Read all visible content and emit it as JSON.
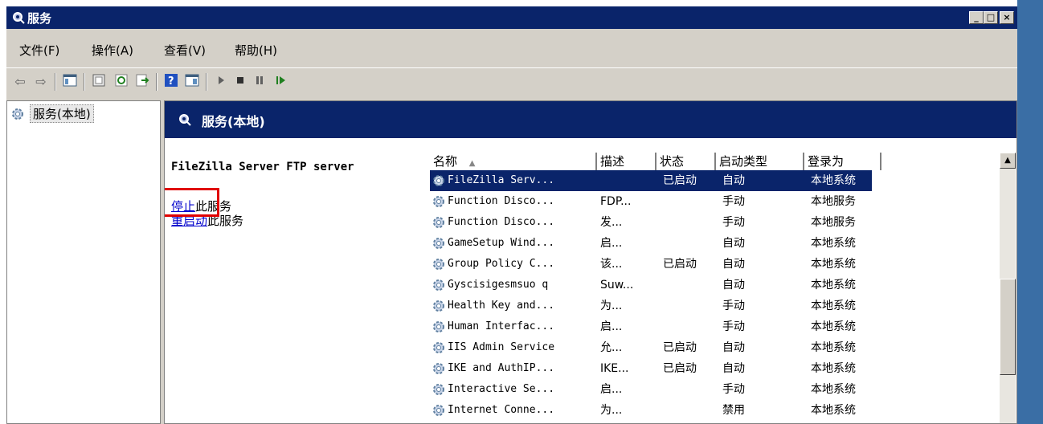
{
  "window": {
    "title": "服务",
    "minimize": "_",
    "maximize": "□",
    "close": "×"
  },
  "menu": [
    "文件(F)",
    "操作(A)",
    "查看(V)",
    "帮助(H)"
  ],
  "toolbar": {
    "icons": [
      "back-icon",
      "forward-icon",
      "console-tree-icon",
      "properties-icon",
      "refresh-icon",
      "export-icon",
      "help-icon",
      "show-hide-icon",
      "play-icon",
      "stop-icon",
      "pause-icon",
      "resume-icon"
    ]
  },
  "tree": {
    "root_label": "服务(本地)"
  },
  "main": {
    "header": "服务(本地)",
    "selected_service": "FileZilla Server FTP server",
    "stop_link": "停止",
    "stop_suffix": "此服务",
    "restart_link": "重启动",
    "restart_suffix": "此服务"
  },
  "columns": [
    "名称",
    "描述",
    "状态",
    "启动类型",
    "登录为"
  ],
  "rows": [
    {
      "name": "FileZilla Serv...",
      "desc": "",
      "status": "已启动",
      "startup": "自动",
      "logon": "本地系统"
    },
    {
      "name": "Function Disco...",
      "desc": "FDP...",
      "status": "",
      "startup": "手动",
      "logon": "本地服务"
    },
    {
      "name": "Function Disco...",
      "desc": "发...",
      "status": "",
      "startup": "手动",
      "logon": "本地服务"
    },
    {
      "name": "GameSetup Wind...",
      "desc": "启...",
      "status": "",
      "startup": "自动",
      "logon": "本地系统"
    },
    {
      "name": "Group Policy C...",
      "desc": "该...",
      "status": "已启动",
      "startup": "自动",
      "logon": "本地系统"
    },
    {
      "name": "Gyscisigesmsuo q",
      "desc": "Suw...",
      "status": "",
      "startup": "自动",
      "logon": "本地系统"
    },
    {
      "name": "Health Key and...",
      "desc": "为...",
      "status": "",
      "startup": "手动",
      "logon": "本地系统"
    },
    {
      "name": "Human Interfac...",
      "desc": "启...",
      "status": "",
      "startup": "手动",
      "logon": "本地系统"
    },
    {
      "name": "IIS Admin Service",
      "desc": "允...",
      "status": "已启动",
      "startup": "自动",
      "logon": "本地系统"
    },
    {
      "name": "IKE and AuthIP...",
      "desc": "IKE...",
      "status": "已启动",
      "startup": "自动",
      "logon": "本地系统"
    },
    {
      "name": "Interactive Se...",
      "desc": "启...",
      "status": "",
      "startup": "手动",
      "logon": "本地系统"
    },
    {
      "name": "Internet Conne...",
      "desc": "为...",
      "status": "",
      "startup": "禁用",
      "logon": "本地系统"
    }
  ],
  "colors": {
    "title_bg": "#0a246a",
    "highlight_box": "#e00000",
    "link": "#0000cc",
    "chrome": "#d4d0c8",
    "desktop": "#3a6ea5"
  }
}
